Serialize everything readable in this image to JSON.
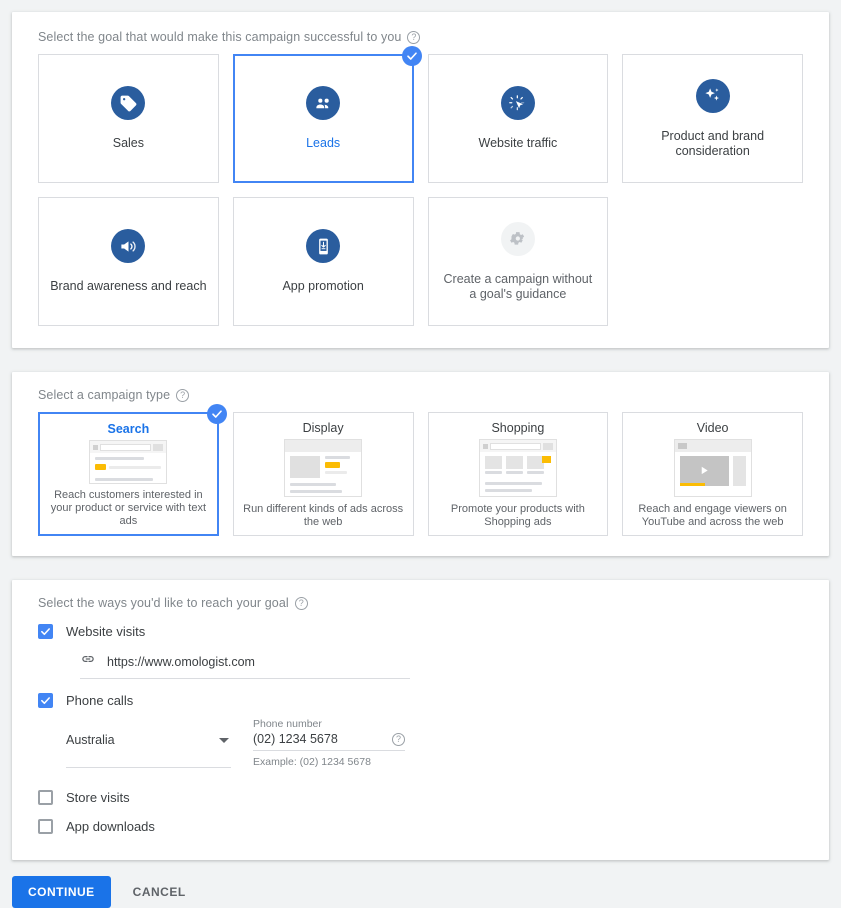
{
  "colors": {
    "accent": "#1a73e8",
    "selected_border": "#4285f4",
    "icon_circle": "#2a5d9e",
    "page_bg": "#f1f3f4",
    "yellow_ad": "#fbbc04"
  },
  "goal_section": {
    "heading": "Select the goal that would make this campaign successful to you",
    "help_icon": "help-circle-icon",
    "cards": [
      {
        "label": "Sales",
        "icon": "tag-icon",
        "selected": false,
        "muted": false
      },
      {
        "label": "Leads",
        "icon": "people-group-icon",
        "selected": true,
        "muted": false
      },
      {
        "label": "Website traffic",
        "icon": "cursor-click-icon",
        "selected": false,
        "muted": false
      },
      {
        "label": "Product and brand consideration",
        "icon": "sparkles-icon",
        "selected": false,
        "muted": false
      },
      {
        "label": "Brand awareness and reach",
        "icon": "megaphone-icon",
        "selected": false,
        "muted": false
      },
      {
        "label": "App promotion",
        "icon": "mobile-app-icon",
        "selected": false,
        "muted": false
      },
      {
        "label": "Create a campaign without a goal's guidance",
        "icon": "gear-icon",
        "selected": false,
        "muted": true
      }
    ]
  },
  "type_section": {
    "heading": "Select a campaign type",
    "help_icon": "help-circle-icon",
    "cards": [
      {
        "title": "Search",
        "desc": "Reach customers interested in your product or service with text ads",
        "thumb": "search-results-thumb",
        "selected": true
      },
      {
        "title": "Display",
        "desc": "Run different kinds of ads across the web",
        "thumb": "display-banner-thumb",
        "selected": false
      },
      {
        "title": "Shopping",
        "desc": "Promote your products with Shopping ads",
        "thumb": "shopping-grid-thumb",
        "selected": false
      },
      {
        "title": "Video",
        "desc": "Reach and engage viewers on YouTube and across the web",
        "thumb": "video-player-thumb",
        "selected": false
      }
    ]
  },
  "ways_section": {
    "heading": "Select the ways you'd like to reach your goal",
    "help_icon": "help-circle-icon",
    "website_visits": {
      "label": "Website visits",
      "checked": true,
      "url_value": "https://www.omologist.com",
      "url_icon": "link-icon"
    },
    "phone_calls": {
      "label": "Phone calls",
      "checked": true,
      "country_value": "Australia",
      "phone_label": "Phone number",
      "phone_value": "(02) 1234 5678",
      "helper": "Example: (02) 1234 5678",
      "help_icon": "help-circle-icon"
    },
    "store_visits": {
      "label": "Store visits",
      "checked": false
    },
    "app_downloads": {
      "label": "App downloads",
      "checked": false
    }
  },
  "footer": {
    "continue_label": "CONTINUE",
    "cancel_label": "CANCEL"
  }
}
